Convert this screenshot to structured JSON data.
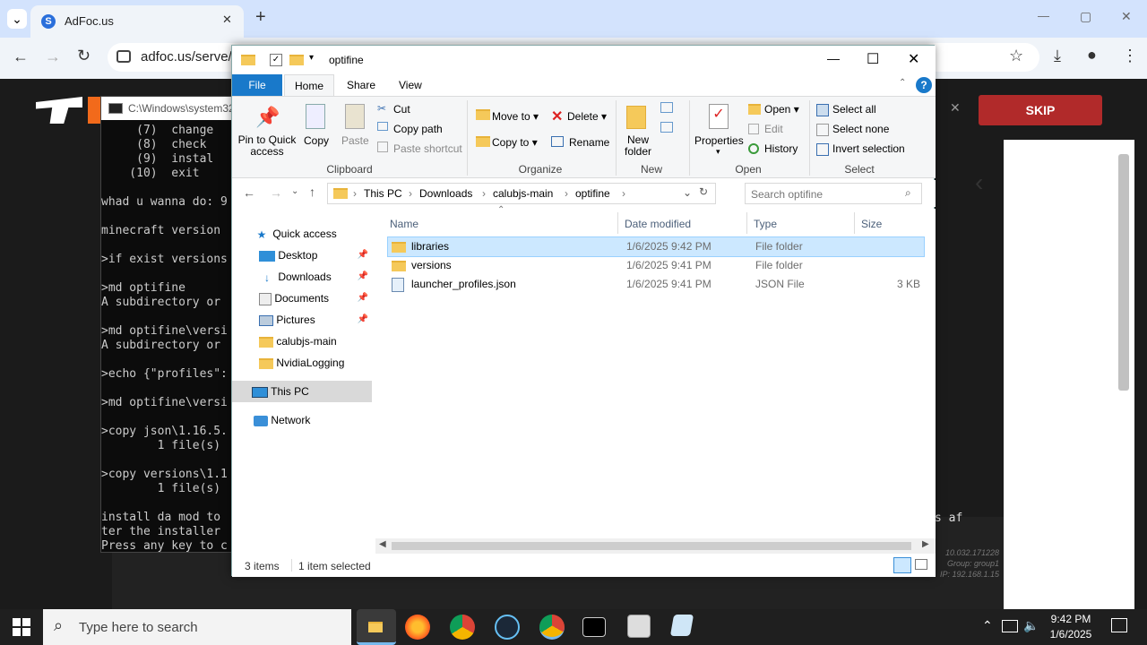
{
  "browser": {
    "tab_title": "AdFoc.us",
    "url": "adfoc.us/serve/?",
    "tab_close": "✕",
    "new_tab": "+",
    "dropdown": "⌄",
    "back": "←",
    "forward": "→",
    "reload": "↻",
    "star": "☆",
    "download": "⤓",
    "profile": "●",
    "menu": "⋮",
    "minimize": "—",
    "maximize": "▢",
    "close": "✕"
  },
  "webpage": {
    "skip_label": "SKIP",
    "close_glyph": "✕",
    "arrow": "‹",
    "footer_lines": [
      "10.032.171228",
      "Group: group1",
      "IP: 192.168.1.15"
    ],
    "footer_partial": "s af"
  },
  "cmd": {
    "title": "C:\\Windows\\system32",
    "lines": [
      "     (7)  change",
      "     (8)  check",
      "     (9)  instal",
      "    (10)  exit",
      "",
      "whad u wanna do: 9",
      "",
      "minecraft version",
      "",
      ">if exist versions",
      "",
      ">md optifine",
      "A subdirectory or",
      "",
      ">md optifine\\versi",
      "A subdirectory or",
      "",
      ">echo {\"profiles\":",
      "",
      ">md optifine\\versi",
      "",
      ">copy json\\1.16.5.",
      "        1 file(s)",
      "",
      ">copy versions\\1.1",
      "        1 file(s)",
      "",
      "install da mod to",
      "ter the installer",
      "Press any key to c"
    ]
  },
  "explorer": {
    "title": "optifine",
    "window_controls": {
      "min": "—",
      "max": "☐",
      "close": "✕"
    },
    "tabs": [
      "File",
      "Home",
      "Share",
      "View"
    ],
    "help": "?",
    "ribbon": {
      "clipboard": {
        "pin": "Pin to Quick access",
        "copy": "Copy",
        "paste": "Paste",
        "cut": "Cut",
        "copy_path": "Copy path",
        "paste_shortcut": "Paste shortcut",
        "label": "Clipboard"
      },
      "organize": {
        "move_to": "Move to",
        "delete": "Delete",
        "copy_to": "Copy to",
        "rename": "Rename",
        "label": "Organize"
      },
      "new": {
        "new_folder": "New folder",
        "label": "New"
      },
      "open": {
        "properties": "Properties",
        "open": "Open",
        "edit": "Edit",
        "history": "History",
        "label": "Open"
      },
      "select": {
        "select_all": "Select all",
        "select_none": "Select none",
        "invert": "Invert selection",
        "label": "Select"
      }
    },
    "breadcrumb": [
      "This PC",
      "Downloads",
      "calubjs-main",
      "optifine"
    ],
    "search_placeholder": "Search optifine",
    "sidebar": [
      {
        "label": "Quick access",
        "pinned": false
      },
      {
        "label": "Desktop",
        "pinned": true
      },
      {
        "label": "Downloads",
        "pinned": true
      },
      {
        "label": "Documents",
        "pinned": true
      },
      {
        "label": "Pictures",
        "pinned": true
      },
      {
        "label": "calubjs-main",
        "pinned": false
      },
      {
        "label": "NvidiaLogging",
        "pinned": false
      },
      {
        "label": "This PC",
        "pinned": false
      },
      {
        "label": "Network",
        "pinned": false
      }
    ],
    "columns": {
      "name": "Name",
      "date": "Date modified",
      "type": "Type",
      "size": "Size"
    },
    "files": [
      {
        "name": "libraries",
        "date": "1/6/2025 9:42 PM",
        "type": "File folder",
        "size": "",
        "selected": true
      },
      {
        "name": "versions",
        "date": "1/6/2025 9:41 PM",
        "type": "File folder",
        "size": "",
        "selected": false
      },
      {
        "name": "launcher_profiles.json",
        "date": "1/6/2025 9:41 PM",
        "type": "JSON File",
        "size": "3 KB",
        "selected": false
      }
    ],
    "status": {
      "count": "3 items",
      "selected": "1 item selected"
    }
  },
  "taskbar": {
    "search_placeholder": "Type here to search",
    "time": "9:42 PM",
    "date": "1/6/2025"
  },
  "colors": {
    "accent": "#1979ca",
    "selection": "#cce8ff",
    "skip": "#b12a2a",
    "folder": "#f5c95a"
  }
}
